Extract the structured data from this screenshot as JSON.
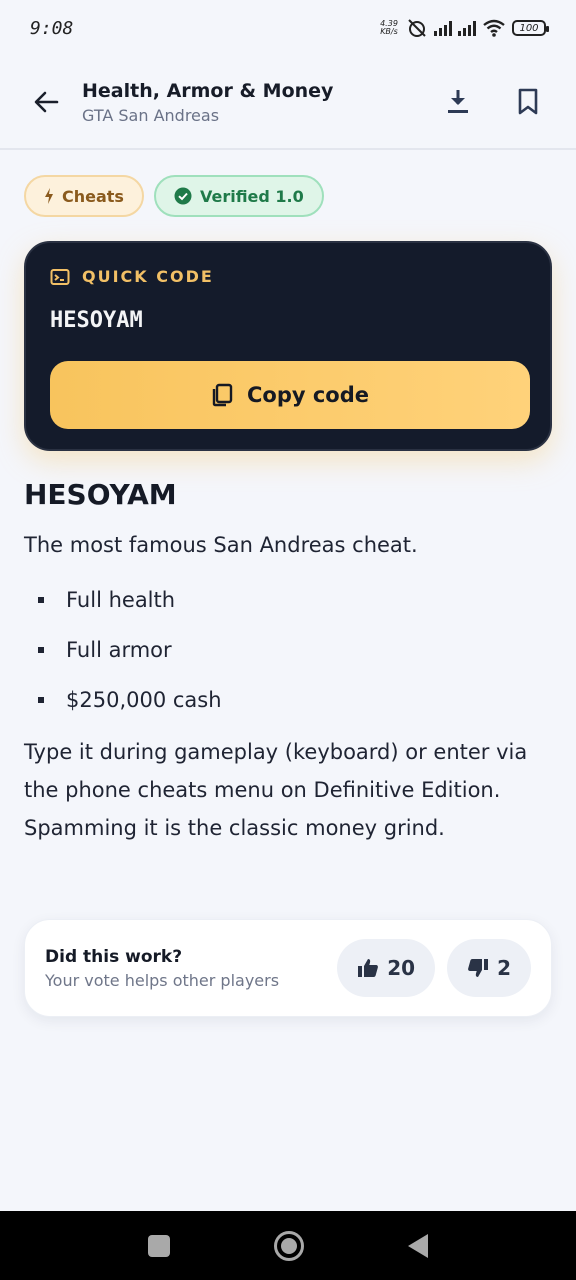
{
  "status_bar": {
    "time": "9:08",
    "net_speed_value": "4.39",
    "net_speed_unit": "KB/s",
    "battery": "100"
  },
  "header": {
    "title": "Health, Armor & Money",
    "subtitle": "GTA San Andreas",
    "icons": [
      "back-arrow-icon",
      "download-icon",
      "bookmark-icon"
    ]
  },
  "chips": {
    "category": "Cheats",
    "verified": "Verified 1.0"
  },
  "quick_code": {
    "label": "QUICK CODE",
    "code": "HESOYAM",
    "copy_label": "Copy code"
  },
  "content": {
    "heading": "HESOYAM",
    "lead": "The most famous San Andreas cheat.",
    "bullets": [
      "Full health",
      "Full armor",
      "$250,000 cash"
    ],
    "paragraph": "Type it during gameplay (keyboard) or enter via the phone cheats menu on Definitive Edition. Spamming it is the classic money grind."
  },
  "vote": {
    "question": "Did this work?",
    "subtitle": "Your vote helps other players",
    "up_count": "20",
    "down_count": "2"
  },
  "colors": {
    "accent": "#f8c45d",
    "card_dark": "#141b2b",
    "verified_green": "#1f7a49",
    "background": "#f4f6fb"
  }
}
